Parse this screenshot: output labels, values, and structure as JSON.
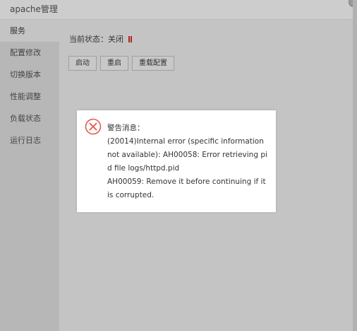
{
  "window": {
    "title": "apache管理"
  },
  "sidebar": {
    "items": [
      {
        "label": "服务"
      },
      {
        "label": "配置修改"
      },
      {
        "label": "切换版本"
      },
      {
        "label": "性能调整"
      },
      {
        "label": "负载状态"
      },
      {
        "label": "运行日志"
      }
    ]
  },
  "main": {
    "status_label": "当前状态：",
    "status_value": "关闭",
    "status_color": "#b0231f",
    "buttons": {
      "start": "启动",
      "restart": "重启",
      "reload": "重载配置"
    }
  },
  "dialog": {
    "icon": "error-circle-x-icon",
    "icon_color": "#e15b4e",
    "title": "警告消息：",
    "body": "(20014)Internal error (specific information not available): AH00058: Error retrieving pid file logs/httpd.pid\nAH00059: Remove it before continuing if it is corrupted."
  }
}
